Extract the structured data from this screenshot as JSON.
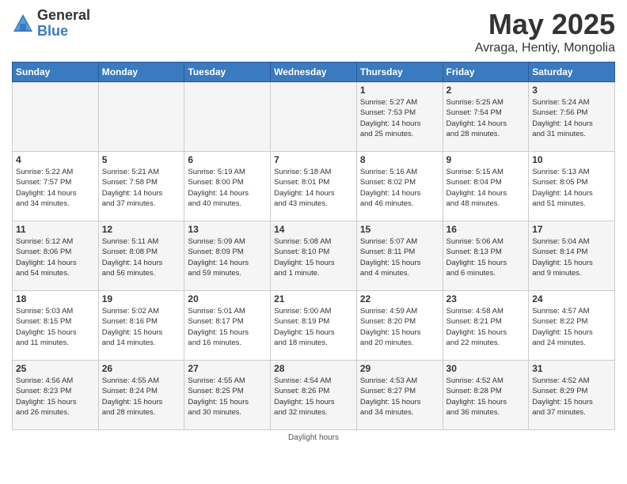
{
  "logo": {
    "general": "General",
    "blue": "Blue"
  },
  "title": "May 2025",
  "location": "Avraga, Hentiy, Mongolia",
  "days_of_week": [
    "Sunday",
    "Monday",
    "Tuesday",
    "Wednesday",
    "Thursday",
    "Friday",
    "Saturday"
  ],
  "weeks": [
    [
      {
        "day": "",
        "info": ""
      },
      {
        "day": "",
        "info": ""
      },
      {
        "day": "",
        "info": ""
      },
      {
        "day": "",
        "info": ""
      },
      {
        "day": "1",
        "info": "Sunrise: 5:27 AM\nSunset: 7:53 PM\nDaylight: 14 hours\nand 25 minutes."
      },
      {
        "day": "2",
        "info": "Sunrise: 5:25 AM\nSunset: 7:54 PM\nDaylight: 14 hours\nand 28 minutes."
      },
      {
        "day": "3",
        "info": "Sunrise: 5:24 AM\nSunset: 7:56 PM\nDaylight: 14 hours\nand 31 minutes."
      }
    ],
    [
      {
        "day": "4",
        "info": "Sunrise: 5:22 AM\nSunset: 7:57 PM\nDaylight: 14 hours\nand 34 minutes."
      },
      {
        "day": "5",
        "info": "Sunrise: 5:21 AM\nSunset: 7:58 PM\nDaylight: 14 hours\nand 37 minutes."
      },
      {
        "day": "6",
        "info": "Sunrise: 5:19 AM\nSunset: 8:00 PM\nDaylight: 14 hours\nand 40 minutes."
      },
      {
        "day": "7",
        "info": "Sunrise: 5:18 AM\nSunset: 8:01 PM\nDaylight: 14 hours\nand 43 minutes."
      },
      {
        "day": "8",
        "info": "Sunrise: 5:16 AM\nSunset: 8:02 PM\nDaylight: 14 hours\nand 46 minutes."
      },
      {
        "day": "9",
        "info": "Sunrise: 5:15 AM\nSunset: 8:04 PM\nDaylight: 14 hours\nand 48 minutes."
      },
      {
        "day": "10",
        "info": "Sunrise: 5:13 AM\nSunset: 8:05 PM\nDaylight: 14 hours\nand 51 minutes."
      }
    ],
    [
      {
        "day": "11",
        "info": "Sunrise: 5:12 AM\nSunset: 8:06 PM\nDaylight: 14 hours\nand 54 minutes."
      },
      {
        "day": "12",
        "info": "Sunrise: 5:11 AM\nSunset: 8:08 PM\nDaylight: 14 hours\nand 56 minutes."
      },
      {
        "day": "13",
        "info": "Sunrise: 5:09 AM\nSunset: 8:09 PM\nDaylight: 14 hours\nand 59 minutes."
      },
      {
        "day": "14",
        "info": "Sunrise: 5:08 AM\nSunset: 8:10 PM\nDaylight: 15 hours\nand 1 minute."
      },
      {
        "day": "15",
        "info": "Sunrise: 5:07 AM\nSunset: 8:11 PM\nDaylight: 15 hours\nand 4 minutes."
      },
      {
        "day": "16",
        "info": "Sunrise: 5:06 AM\nSunset: 8:13 PM\nDaylight: 15 hours\nand 6 minutes."
      },
      {
        "day": "17",
        "info": "Sunrise: 5:04 AM\nSunset: 8:14 PM\nDaylight: 15 hours\nand 9 minutes."
      }
    ],
    [
      {
        "day": "18",
        "info": "Sunrise: 5:03 AM\nSunset: 8:15 PM\nDaylight: 15 hours\nand 11 minutes."
      },
      {
        "day": "19",
        "info": "Sunrise: 5:02 AM\nSunset: 8:16 PM\nDaylight: 15 hours\nand 14 minutes."
      },
      {
        "day": "20",
        "info": "Sunrise: 5:01 AM\nSunset: 8:17 PM\nDaylight: 15 hours\nand 16 minutes."
      },
      {
        "day": "21",
        "info": "Sunrise: 5:00 AM\nSunset: 8:19 PM\nDaylight: 15 hours\nand 18 minutes."
      },
      {
        "day": "22",
        "info": "Sunrise: 4:59 AM\nSunset: 8:20 PM\nDaylight: 15 hours\nand 20 minutes."
      },
      {
        "day": "23",
        "info": "Sunrise: 4:58 AM\nSunset: 8:21 PM\nDaylight: 15 hours\nand 22 minutes."
      },
      {
        "day": "24",
        "info": "Sunrise: 4:57 AM\nSunset: 8:22 PM\nDaylight: 15 hours\nand 24 minutes."
      }
    ],
    [
      {
        "day": "25",
        "info": "Sunrise: 4:56 AM\nSunset: 8:23 PM\nDaylight: 15 hours\nand 26 minutes."
      },
      {
        "day": "26",
        "info": "Sunrise: 4:55 AM\nSunset: 8:24 PM\nDaylight: 15 hours\nand 28 minutes."
      },
      {
        "day": "27",
        "info": "Sunrise: 4:55 AM\nSunset: 8:25 PM\nDaylight: 15 hours\nand 30 minutes."
      },
      {
        "day": "28",
        "info": "Sunrise: 4:54 AM\nSunset: 8:26 PM\nDaylight: 15 hours\nand 32 minutes."
      },
      {
        "day": "29",
        "info": "Sunrise: 4:53 AM\nSunset: 8:27 PM\nDaylight: 15 hours\nand 34 minutes."
      },
      {
        "day": "30",
        "info": "Sunrise: 4:52 AM\nSunset: 8:28 PM\nDaylight: 15 hours\nand 36 minutes."
      },
      {
        "day": "31",
        "info": "Sunrise: 4:52 AM\nSunset: 8:29 PM\nDaylight: 15 hours\nand 37 minutes."
      }
    ]
  ],
  "footer": "Daylight hours"
}
